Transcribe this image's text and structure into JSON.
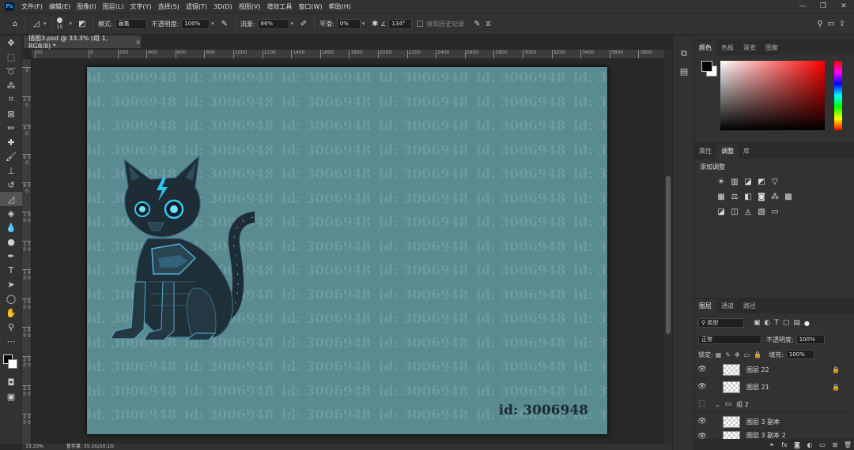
{
  "menubar": {
    "logo": "Ps",
    "items": [
      "文件(F)",
      "编辑(E)",
      "图像(I)",
      "图层(L)",
      "文字(Y)",
      "选择(S)",
      "滤镜(T)",
      "3D(D)",
      "视图(V)",
      "增效工具",
      "窗口(W)",
      "帮助(H)"
    ],
    "window_controls": [
      "—",
      "❐",
      "✕"
    ]
  },
  "options": {
    "brush_size": "15",
    "mode_label": "模式:",
    "mode_value": "画笔",
    "opacity_label": "不透明度:",
    "opacity_value": "100%",
    "flow_label": "流量:",
    "flow_value": "86%",
    "smooth_label": "平滑:",
    "smooth_value": "0%",
    "angle_value": "134°",
    "history_label": "抹到历史记录"
  },
  "document": {
    "tab_title": "插图3.psd @ 33.3% (组 1, RGB/8) *",
    "tab_close": "×"
  },
  "ruler": {
    "top": [
      "00",
      "0",
      "200",
      "400",
      "600",
      "800",
      "1000",
      "1200",
      "1400",
      "1600",
      "1800",
      "2000",
      "2200",
      "2400",
      "2600",
      "2800",
      "3000",
      "3200",
      "3400",
      "3600",
      "3800"
    ],
    "left": [
      "0",
      "2 0 0",
      "4 0 0",
      "6 0 0",
      "8 0 0",
      "1 0 0 0",
      "1 2 0 0",
      "1 4 0 0",
      "1 6 0 0",
      "1 8 0 0",
      "2 0 0 0",
      "2 2 0 0",
      "2 4 0 0"
    ]
  },
  "canvas": {
    "background": "#5a8b91",
    "watermark_text": "id: 3006948",
    "id_label": "id: 3006948"
  },
  "status": {
    "zoom": "33.33%",
    "doc_info": "暂存盘: 35.1G/10.1G"
  },
  "color_panel": {
    "tabs": [
      "颜色",
      "色板",
      "渐变",
      "图案"
    ],
    "foreground": "#000000",
    "background": "#ffffff"
  },
  "adjustments_panel": {
    "tabs": [
      "属性",
      "调整",
      "库"
    ],
    "title": "添加调整"
  },
  "layers_panel": {
    "tabs": [
      "图层",
      "通道",
      "路径"
    ],
    "filter_value": "类型",
    "blend_mode": "正常",
    "opacity_label": "不透明度:",
    "opacity_value": "100%",
    "lock_label": "锁定:",
    "fill_label": "填充:",
    "fill_value": "100%",
    "layers": [
      {
        "name": "图层 22",
        "visible": true,
        "locked": true
      },
      {
        "name": "图层 21",
        "visible": true,
        "locked": true
      },
      {
        "name": "组 2",
        "visible": false,
        "locked": false
      },
      {
        "name": "图层 3 副本",
        "visible": true,
        "locked": false
      },
      {
        "name": "图层 3 副本 2",
        "visible": true,
        "locked": false
      }
    ]
  },
  "icons": {
    "eye": "eye-icon",
    "lock": "lock-icon",
    "folder": "folder-icon",
    "home": "home-icon",
    "eraser": "eraser-icon",
    "search": "search-icon"
  }
}
